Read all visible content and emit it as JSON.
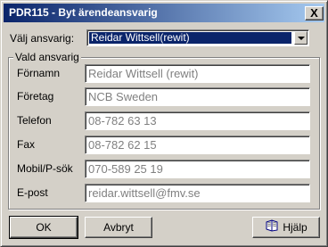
{
  "window": {
    "title": "PDR115 - Byt ärendeansvarig",
    "close_label": "X"
  },
  "selector": {
    "label": "Välj ansvarig:",
    "selected_value": "Reidar Wittsell(rewit)"
  },
  "group": {
    "title": "Vald ansvarig",
    "fields": [
      {
        "label": "Förnamn",
        "value": "Reidar Wittsell (rewit)"
      },
      {
        "label": "Företag",
        "value": "NCB Sweden"
      },
      {
        "label": "Telefon",
        "value": "08-782 63 13"
      },
      {
        "label": "Fax",
        "value": "08-782 62 15"
      },
      {
        "label": "Mobil/P-sök",
        "value": "070-589 25 19"
      },
      {
        "label": "E-post",
        "value": "reidar.wittsell@fmv.se"
      }
    ]
  },
  "buttons": {
    "ok": "OK",
    "cancel": "Avbryt",
    "help": "Hjälp"
  },
  "colors": {
    "face": "#d4d0c8",
    "title_start": "#0a246a",
    "title_end": "#a6caf0",
    "selection": "#0a246a",
    "disabled_text": "#808080"
  },
  "icons": {
    "help": "help-book-icon",
    "dropdown": "chevron-down-icon"
  }
}
